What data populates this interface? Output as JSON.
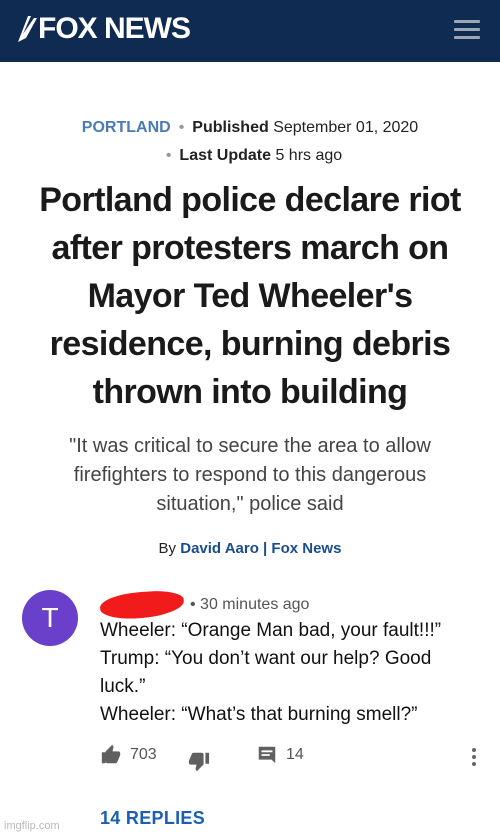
{
  "header": {
    "logo_text": "FOX NEWS",
    "background": "#0f2b52"
  },
  "article": {
    "section": "PORTLAND",
    "published_label": "Published",
    "published_date": "September 01, 2020",
    "updated_label": "Last Update",
    "updated_value": "5 hrs ago",
    "headline": "Portland police declare riot after protesters march on Mayor Ted Wheeler's residence, burning debris thrown into building",
    "subhead": "\"It was critical to secure the area to allow firefighters to respond to this dangerous situation,\" police said",
    "byline_prefix": "By",
    "author": "David Aaro",
    "separator": "|",
    "outlet": "Fox News"
  },
  "comment": {
    "avatar_letter": "T",
    "avatar_color": "#6a3fc9",
    "time": "• 30 minutes ago",
    "lines": [
      "Wheeler: “Orange Man bad, your fault!!!”",
      "Trump: “You don’t want our help? Good luck.”",
      "Wheeler: “What’s that burning smell?”"
    ],
    "likes": "703",
    "reply_count": "14",
    "replies_label": "14 REPLIES"
  },
  "watermark": "imgflip.com"
}
